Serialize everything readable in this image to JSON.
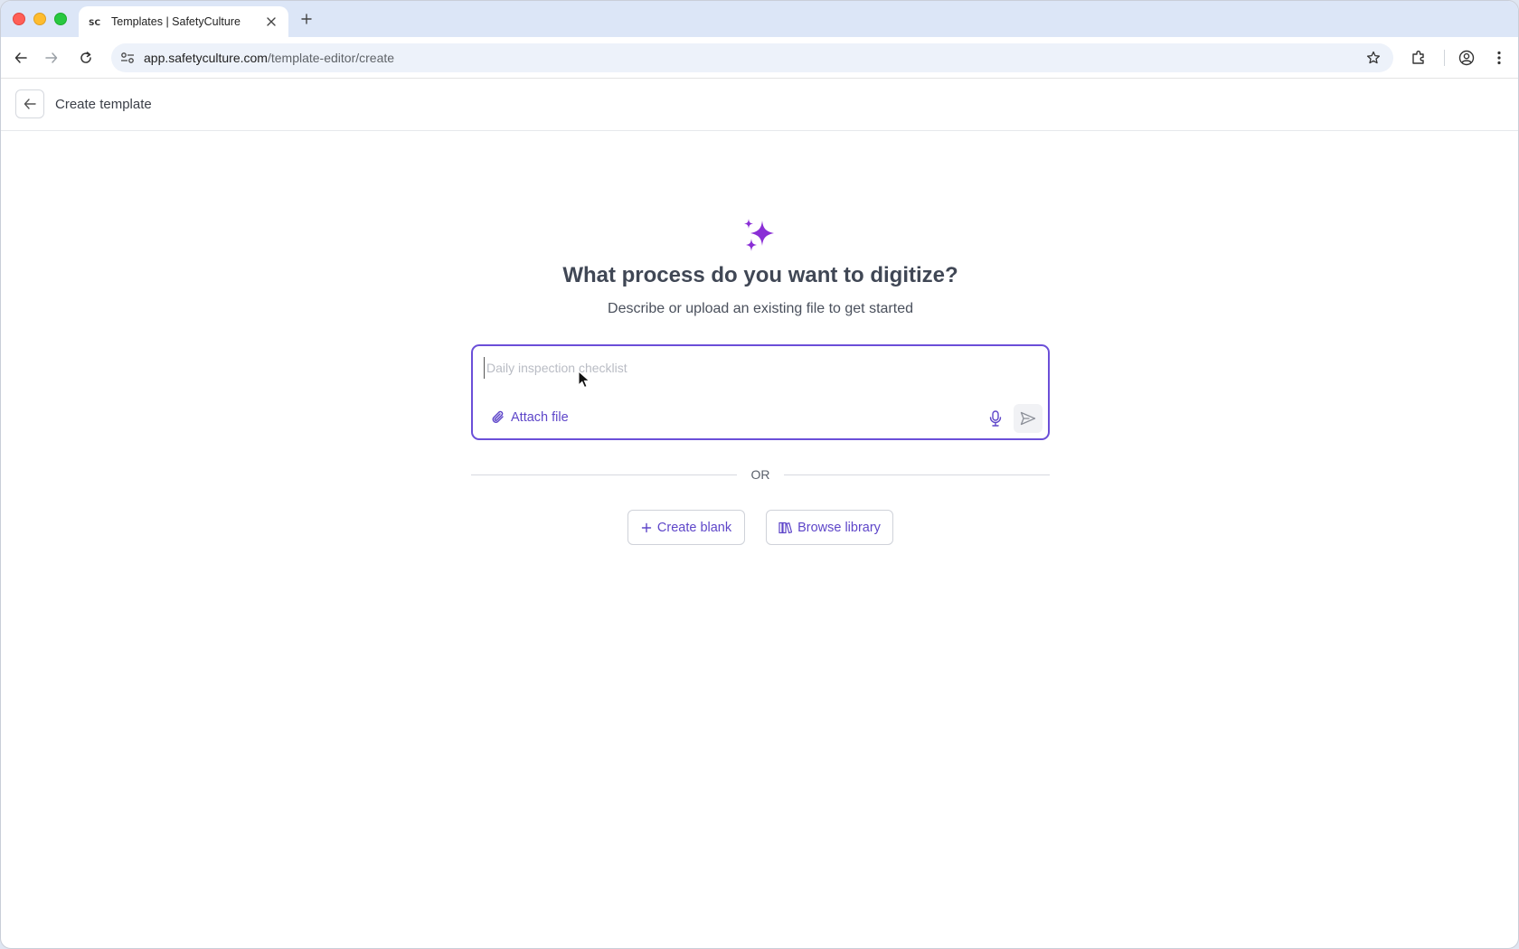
{
  "browser": {
    "tab_title": "Templates | SafetyCulture",
    "url_host": "app.safetyculture.com",
    "url_path": "/template-editor/create"
  },
  "header": {
    "page_title": "Create template"
  },
  "main": {
    "headline": "What process do you want to digitize?",
    "subheadline": "Describe or upload an existing file to get started",
    "prompt": {
      "placeholder": "Daily inspection checklist",
      "value": "",
      "attach_label": "Attach file"
    },
    "divider_text": "OR",
    "create_blank_label": "Create blank",
    "browse_library_label": "Browse library"
  },
  "colors": {
    "accent": "#6b4fd8",
    "accent_text": "#5e46c9",
    "sparkle": "#8a2ed6"
  },
  "icons": [
    "sc-favicon-icon",
    "close-icon",
    "plus-icon",
    "back-arrow-icon",
    "forward-arrow-icon",
    "reload-icon",
    "site-settings-icon",
    "star-icon",
    "extensions-icon",
    "profile-icon",
    "kebab-menu-icon",
    "sparkles-icon",
    "paperclip-icon",
    "microphone-icon",
    "send-icon",
    "books-icon"
  ]
}
